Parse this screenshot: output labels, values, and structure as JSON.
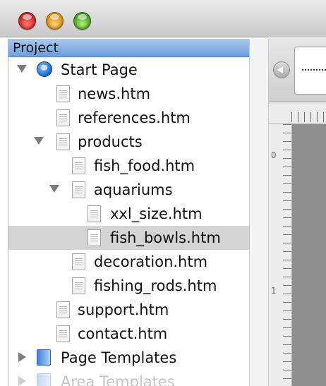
{
  "project_panel": {
    "header": "Project",
    "items": [
      {
        "label": "Start Page",
        "icon": "globe-icon",
        "disclosure": "open"
      },
      {
        "label": "news.htm",
        "icon": "document-icon"
      },
      {
        "label": "references.htm",
        "icon": "document-icon"
      },
      {
        "label": "products",
        "icon": "document-icon",
        "disclosure": "open"
      },
      {
        "label": "fish_food.htm",
        "icon": "document-icon"
      },
      {
        "label": "aquariums",
        "icon": "document-icon",
        "disclosure": "open"
      },
      {
        "label": "xxl_size.htm",
        "icon": "document-icon"
      },
      {
        "label": "fish_bowls.htm",
        "icon": "document-icon",
        "selected": true
      },
      {
        "label": "decoration.htm",
        "icon": "document-icon"
      },
      {
        "label": "fishing_rods.htm",
        "icon": "document-icon"
      },
      {
        "label": "support.htm",
        "icon": "document-icon"
      },
      {
        "label": "contact.htm",
        "icon": "document-icon"
      },
      {
        "label": "Page Templates",
        "icon": "folder-icon",
        "disclosure": "closed"
      },
      {
        "label": "Area Templates",
        "icon": "folder-icon",
        "disclosure": "closed",
        "faded": true
      }
    ]
  },
  "editor": {
    "ruler_labels": [
      "0",
      "1"
    ]
  },
  "colors": {
    "panel_header": "#6d9fde",
    "selection": "#d4d4d4"
  }
}
